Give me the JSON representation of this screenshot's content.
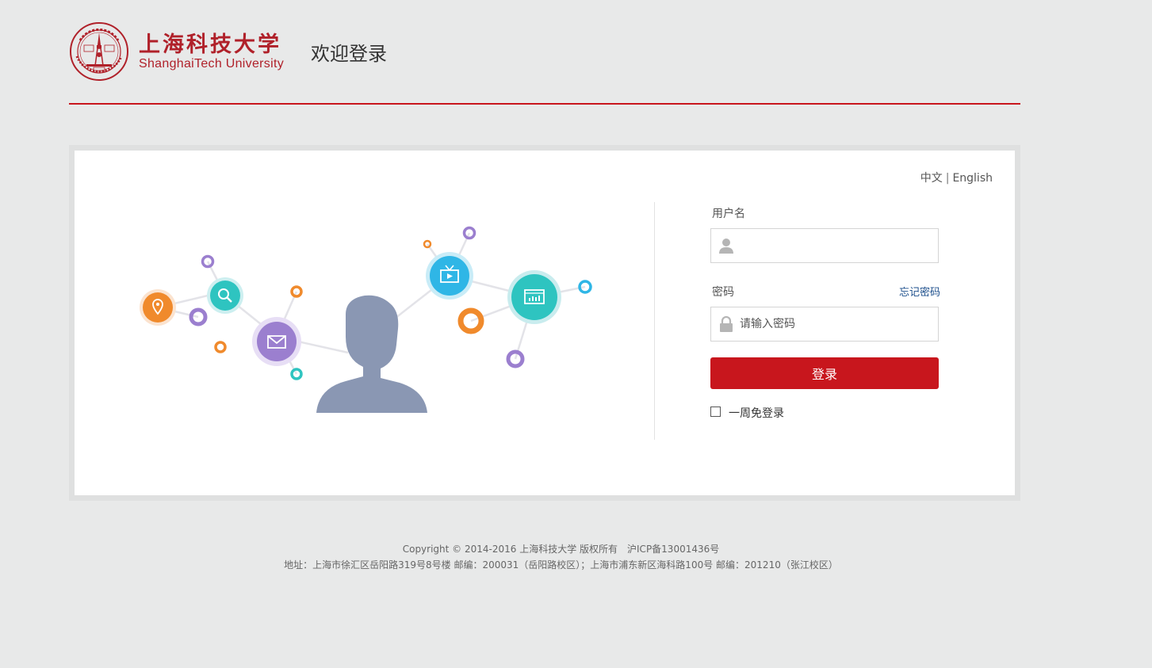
{
  "header": {
    "logo_cn": "上海科技大学",
    "logo_en": "ShanghaiTech University",
    "welcome": "欢迎登录"
  },
  "lang": {
    "zh": "中文",
    "separator": "|",
    "en": "English"
  },
  "form": {
    "username_label": "用户名",
    "username_value": "",
    "password_label": "密码",
    "password_placeholder": "请输入密码",
    "forgot_link": "忘记密码",
    "login_button": "登录",
    "remember_label": "一周免登录",
    "remember_checked": false
  },
  "footer": {
    "copyright": "Copyright © 2014-2016 上海科技大学 版权所有　沪ICP备13001436号",
    "address": "地址：上海市徐汇区岳阳路319号8号楼 邮编：200031（岳阳路校区）；上海市浦东新区海科路100号 邮编：201210（张江校区）"
  },
  "colors": {
    "brand_red": "#c8161d",
    "logo_red": "#b0212a",
    "link_blue": "#1d4f8c",
    "orange": "#f08a2c",
    "teal": "#2ec4c0",
    "purple": "#9b7fcf",
    "blue": "#2fb6e6",
    "person": "#8a97b3"
  },
  "icons": [
    "university-seal-icon",
    "user-icon",
    "lock-icon",
    "location-icon",
    "search-icon",
    "mail-icon",
    "tv-icon",
    "chart-icon"
  ]
}
